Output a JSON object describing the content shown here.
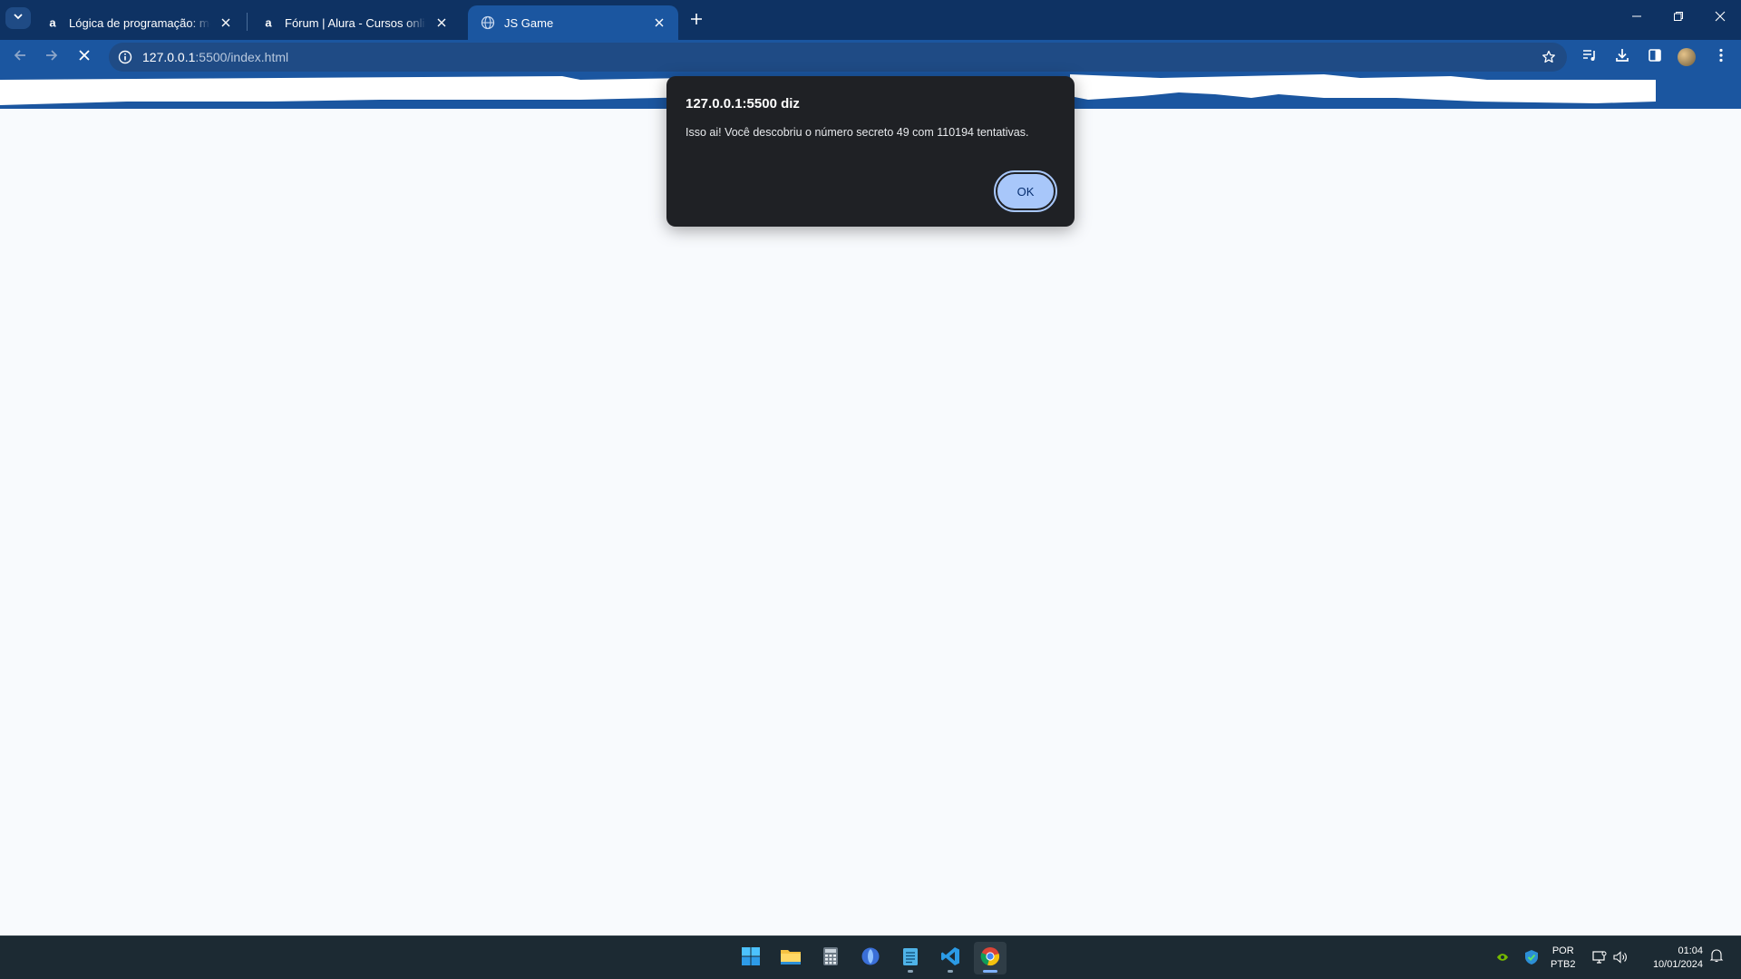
{
  "browser": {
    "tabs": [
      {
        "title": "Lógica de programação: mergulhe",
        "favicon": "alura-icon"
      },
      {
        "title": "Fórum | Alura - Cursos online de",
        "favicon": "alura-icon"
      },
      {
        "title": "JS Game",
        "favicon": "globe-icon",
        "active": true
      }
    ],
    "address": {
      "host": "127.0.0.1",
      "path": ":5500/index.html"
    }
  },
  "dialog": {
    "origin": "127.0.0.1:5500 diz",
    "message": "Isso ai! Você descobriu o número secreto 49 com 110194 tentativas.",
    "ok_label": "OK"
  },
  "taskbar": {
    "apps": [
      "start-icon",
      "file-explorer-icon",
      "calculator-icon",
      "app-icon",
      "notepad-icon",
      "vscode-icon",
      "chrome-icon"
    ],
    "language": {
      "line1": "POR",
      "line2": "PTB2"
    },
    "clock": {
      "time": "01:04",
      "date": "10/01/2024"
    }
  },
  "colors": {
    "tabstrip": "#0e3263",
    "toolbar": "#1b56a0",
    "dialog_bg": "#1f2125",
    "ok_button": "#a8c7fa",
    "taskbar": "#1c2a33"
  }
}
